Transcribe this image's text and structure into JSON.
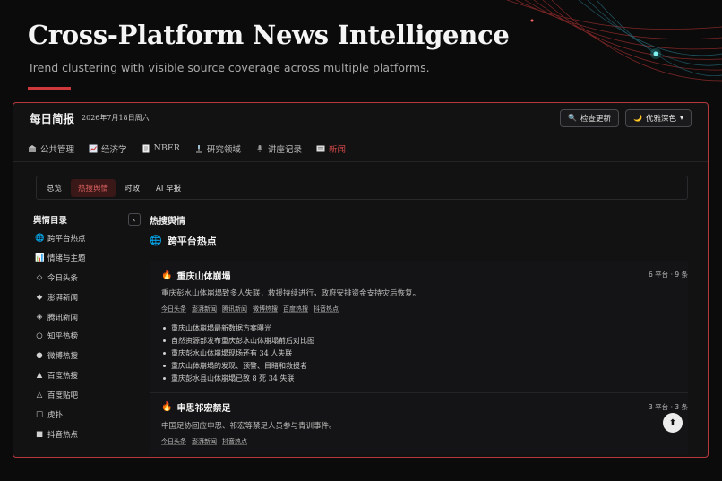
{
  "hero": {
    "title": "Cross-Platform News Intelligence",
    "subtitle": "Trend clustering with visible source coverage across multiple platforms.",
    "accent": "#d0393b"
  },
  "app": {
    "brand": "每日简报",
    "date": "2026年7月18日周六",
    "actions": {
      "check_update": "检查更新",
      "theme": "优雅深色"
    }
  },
  "nav": {
    "items": [
      {
        "label": "公共管理",
        "icon": "building-icon"
      },
      {
        "label": "经济学",
        "icon": "chart-icon"
      },
      {
        "label": "NBER",
        "icon": "document-icon"
      },
      {
        "label": "研究领域",
        "icon": "microscope-icon"
      },
      {
        "label": "讲座记录",
        "icon": "mic-icon"
      },
      {
        "label": "新闻",
        "icon": "newspaper-icon",
        "active": true
      }
    ]
  },
  "subtabs": [
    {
      "label": "总览"
    },
    {
      "label": "热搜舆情",
      "active": true
    },
    {
      "label": "时政"
    },
    {
      "label": "AI 早报"
    }
  ],
  "sidebar": {
    "title": "舆情目录",
    "collapse": "‹",
    "items": [
      {
        "icon": "globe-icon",
        "glyph": "🌐",
        "label": "跨平台热点"
      },
      {
        "icon": "chart-icon",
        "glyph": "📊",
        "label": "情绪与主题"
      },
      {
        "icon": "diamond-outline-icon",
        "glyph": "◇",
        "label": "今日头条"
      },
      {
        "icon": "diamond-icon",
        "glyph": "◆",
        "label": "澎湃新闻"
      },
      {
        "icon": "small-diamond-icon",
        "glyph": "◈",
        "label": "腾讯新闻"
      },
      {
        "icon": "circle-outline-icon",
        "glyph": "○",
        "label": "知乎热榜"
      },
      {
        "icon": "circle-icon",
        "glyph": "●",
        "label": "微博热搜"
      },
      {
        "icon": "triangle-icon",
        "glyph": "▲",
        "label": "百度热搜"
      },
      {
        "icon": "triangle-outline-icon",
        "glyph": "△",
        "label": "百度贴吧"
      },
      {
        "icon": "square-outline-icon",
        "glyph": "□",
        "label": "虎扑"
      },
      {
        "icon": "square-icon",
        "glyph": "■",
        "label": "抖音热点"
      }
    ]
  },
  "main": {
    "heading": "热搜舆情",
    "section": {
      "icon": "globe-icon",
      "glyph": "🌐",
      "title": "跨平台热点"
    },
    "cards": [
      {
        "title": "重庆山体崩塌",
        "meta": "6 平台 · 9 条",
        "desc": "重庆彭水山体崩塌致多人失联，救援持续进行，政府安排资金支持灾后恢复。",
        "tags": [
          "今日头条",
          "澎湃新闻",
          "腾讯新闻",
          "微博热搜",
          "百度热搜",
          "抖音热点"
        ],
        "bullets": [
          "重庆山体崩塌最新数据方案曝光",
          "自然资源部发布重庆彭水山体崩塌前后对比图",
          "重庆彭水山体崩塌现场还有 34 人失联",
          "重庆山体崩塌的发现、预警、目睹和救援者",
          "重庆彭水县山体崩塌已致 8 死 34 失联"
        ]
      },
      {
        "title": "申思祁宏禁足",
        "meta": "3 平台 · 3 条",
        "desc": "中国足协回应申思、祁宏等禁足人员参与青训事件。",
        "tags": [
          "今日头条",
          "澎湃新闻",
          "抖音热点"
        ],
        "bullets": []
      }
    ]
  },
  "fab": {
    "glyph": "⬆",
    "icon": "arrow-up-icon"
  }
}
